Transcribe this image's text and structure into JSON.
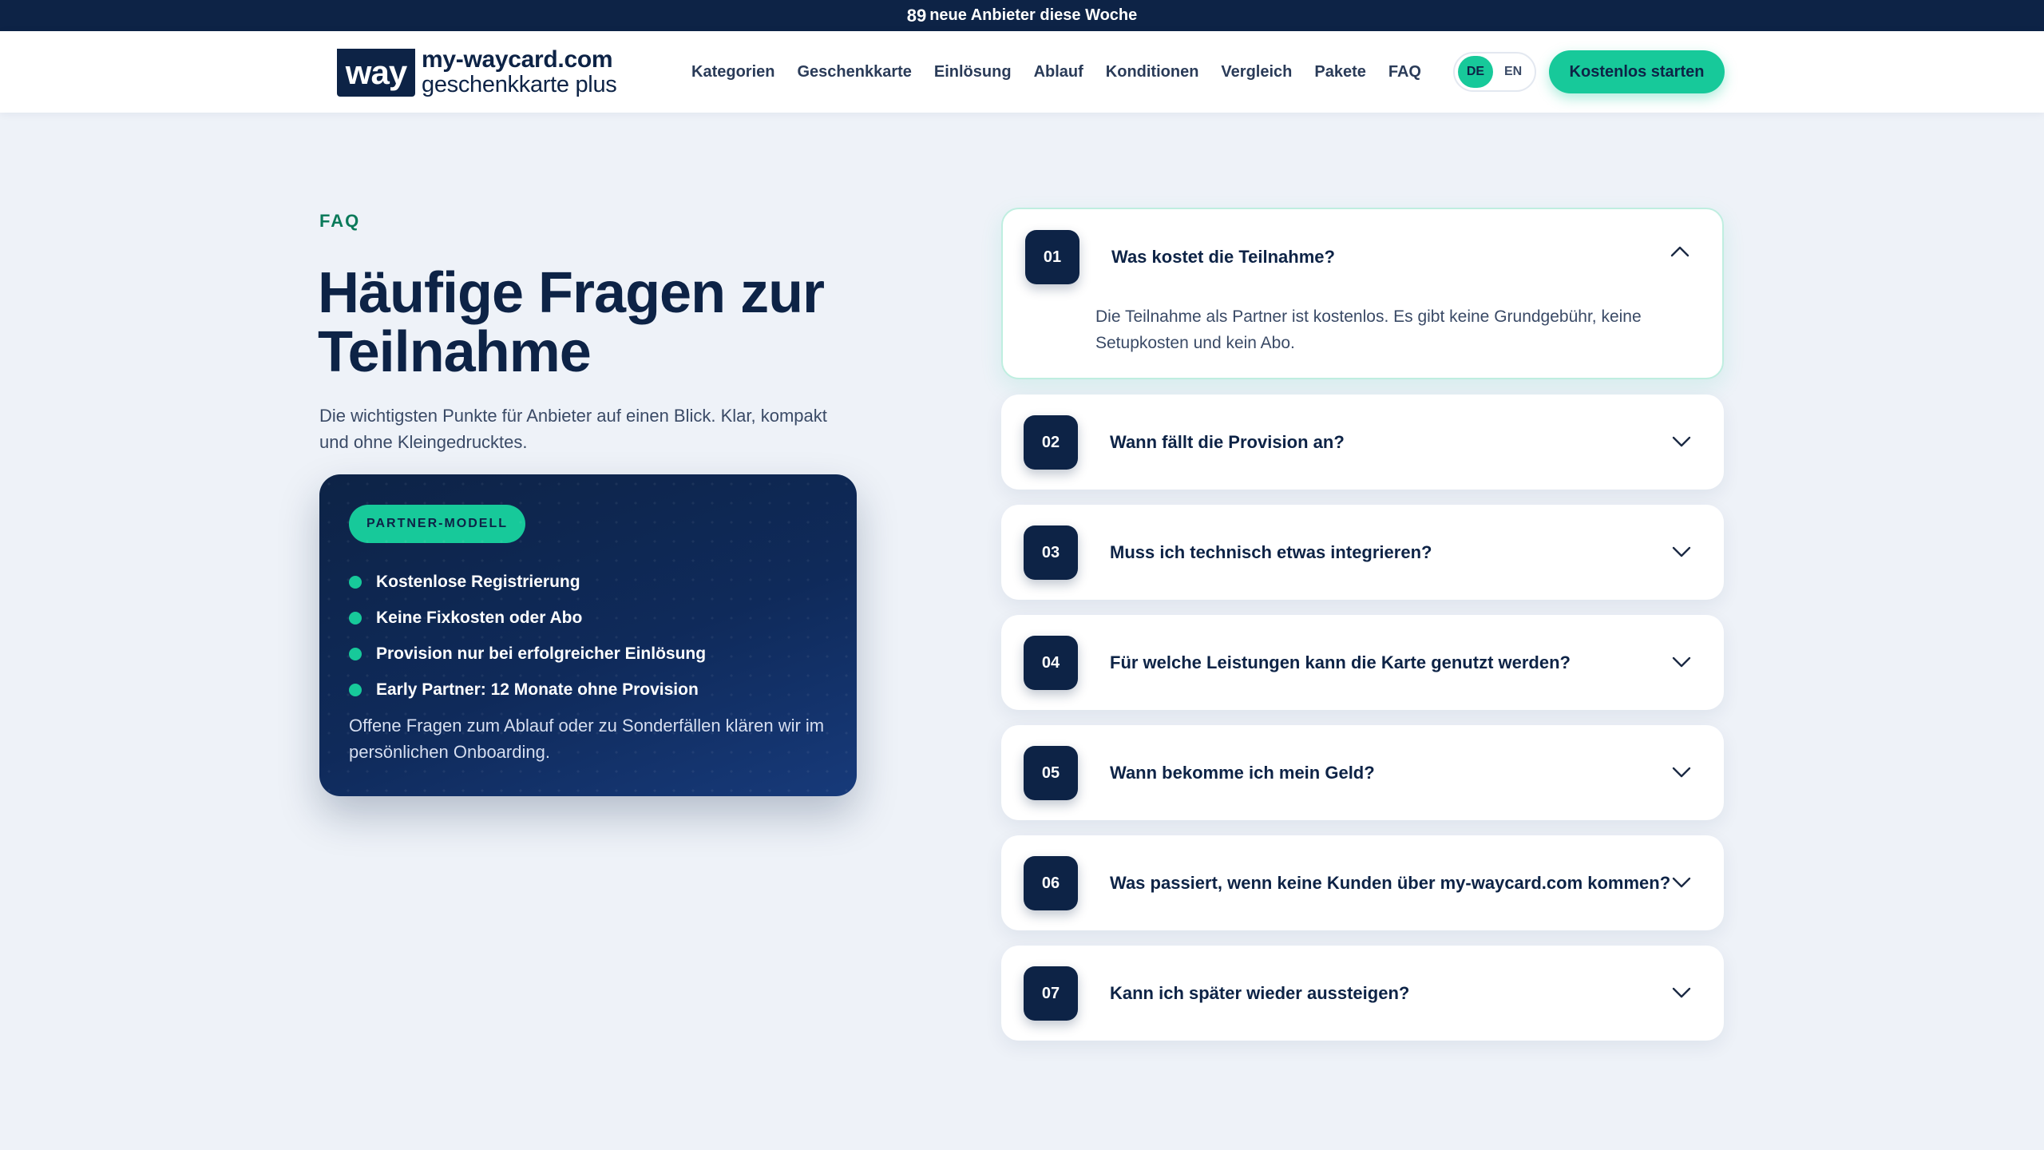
{
  "announcement": {
    "count": "89",
    "text": "neue Anbieter diese Woche"
  },
  "logo": {
    "mark": "way",
    "line1": "my-waycard.com",
    "line2": "geschenkkarte plus"
  },
  "nav": [
    "Kategorien",
    "Geschenkkarte",
    "Einlösung",
    "Ablauf",
    "Konditionen",
    "Vergleich",
    "Pakete",
    "FAQ"
  ],
  "lang": {
    "active": "DE",
    "other": "EN"
  },
  "cta": "Kostenlos starten",
  "section": {
    "eyebrow": "FAQ",
    "title": "Häufige Fragen zur Teilnahme",
    "intro": "Die wichtigsten Punkte für Anbieter auf einen Blick. Klar, kompakt und ohne Kleingedrucktes."
  },
  "partner_card": {
    "badge": "PARTNER-MODELL",
    "points": [
      "Kostenlose Registrierung",
      "Keine Fixkosten oder Abo",
      "Provision nur bei erfolgreicher Einlösung",
      "Early Partner: 12 Monate ohne Provision"
    ],
    "note": "Offene Fragen zum Ablauf oder zu Sonderfällen klären wir im persönlichen Onboarding."
  },
  "faq": [
    {
      "num": "01",
      "question": "Was kostet die Teilnahme?",
      "answer": "Die Teilnahme als Partner ist kostenlos. Es gibt keine Grundgebühr, keine Setupkosten und kein Abo."
    },
    {
      "num": "02",
      "question": "Wann fällt die Provision an?"
    },
    {
      "num": "03",
      "question": "Muss ich technisch etwas integrieren?"
    },
    {
      "num": "04",
      "question": "Für welche Leistungen kann die Karte genutzt werden?"
    },
    {
      "num": "05",
      "question": "Wann bekomme ich mein Geld?"
    },
    {
      "num": "06",
      "question": "Was passiert, wenn keine Kunden über my-waycard.com kommen?"
    },
    {
      "num": "07",
      "question": "Kann ich später wieder aussteigen?"
    }
  ],
  "colors": {
    "navy": "#0d2346",
    "accent": "#17c99a",
    "background": "#eef2f8"
  }
}
